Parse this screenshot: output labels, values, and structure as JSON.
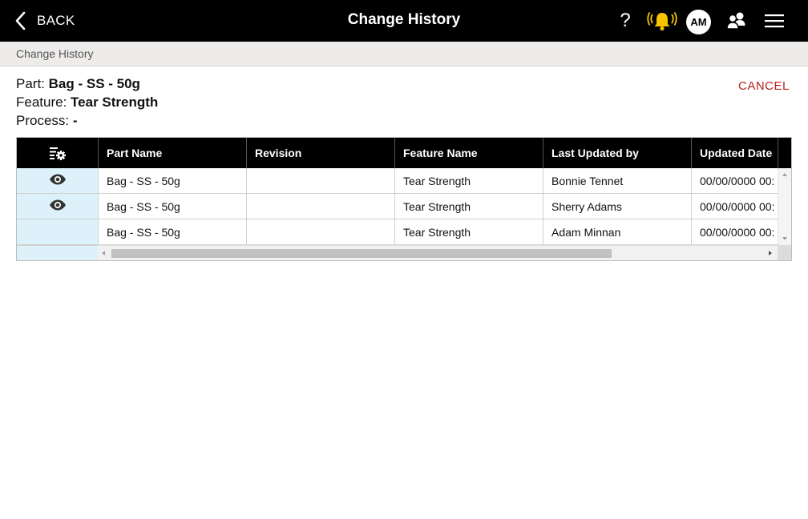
{
  "topbar": {
    "back_label": "BACK",
    "title": "Change History",
    "help_glyph": "?",
    "avatar_initials": "AM",
    "icons": [
      "chevron-left-icon",
      "help-icon",
      "alarm-bell-icon",
      "user-group-icon",
      "hamburger-menu-icon"
    ],
    "bell_color": "#f6c400"
  },
  "breadcrumb": {
    "label": "Change History"
  },
  "info": {
    "part_label": "Part:",
    "part_value": "Bag - SS - 50g",
    "feature_label": "Feature:",
    "feature_value": "Tear Strength",
    "process_label": "Process:",
    "process_value": "-"
  },
  "cancel_label": "CANCEL",
  "colors": {
    "accent_red": "#b3211d",
    "pinned_column": "#ddf1fb",
    "header_bg": "#000000"
  },
  "grid": {
    "columns": [
      "Part Name",
      "Revision",
      "Feature Name",
      "Last Updated by",
      "Updated Date"
    ],
    "rows": [
      {
        "part": "Bag - SS - 50g",
        "revision": "",
        "feature": "Tear Strength",
        "updated_by": "Bonnie Tennet",
        "date": "00/00/0000 00:",
        "has_view": true
      },
      {
        "part": "Bag - SS - 50g",
        "revision": "",
        "feature": "Tear Strength",
        "updated_by": "Sherry Adams",
        "date": "00/00/0000 00:",
        "has_view": true
      },
      {
        "part": "Bag - SS - 50g",
        "revision": "",
        "feature": "Tear Strength",
        "updated_by": "Adam Minnan",
        "date": "00/00/0000 00:",
        "has_view": false
      }
    ]
  }
}
